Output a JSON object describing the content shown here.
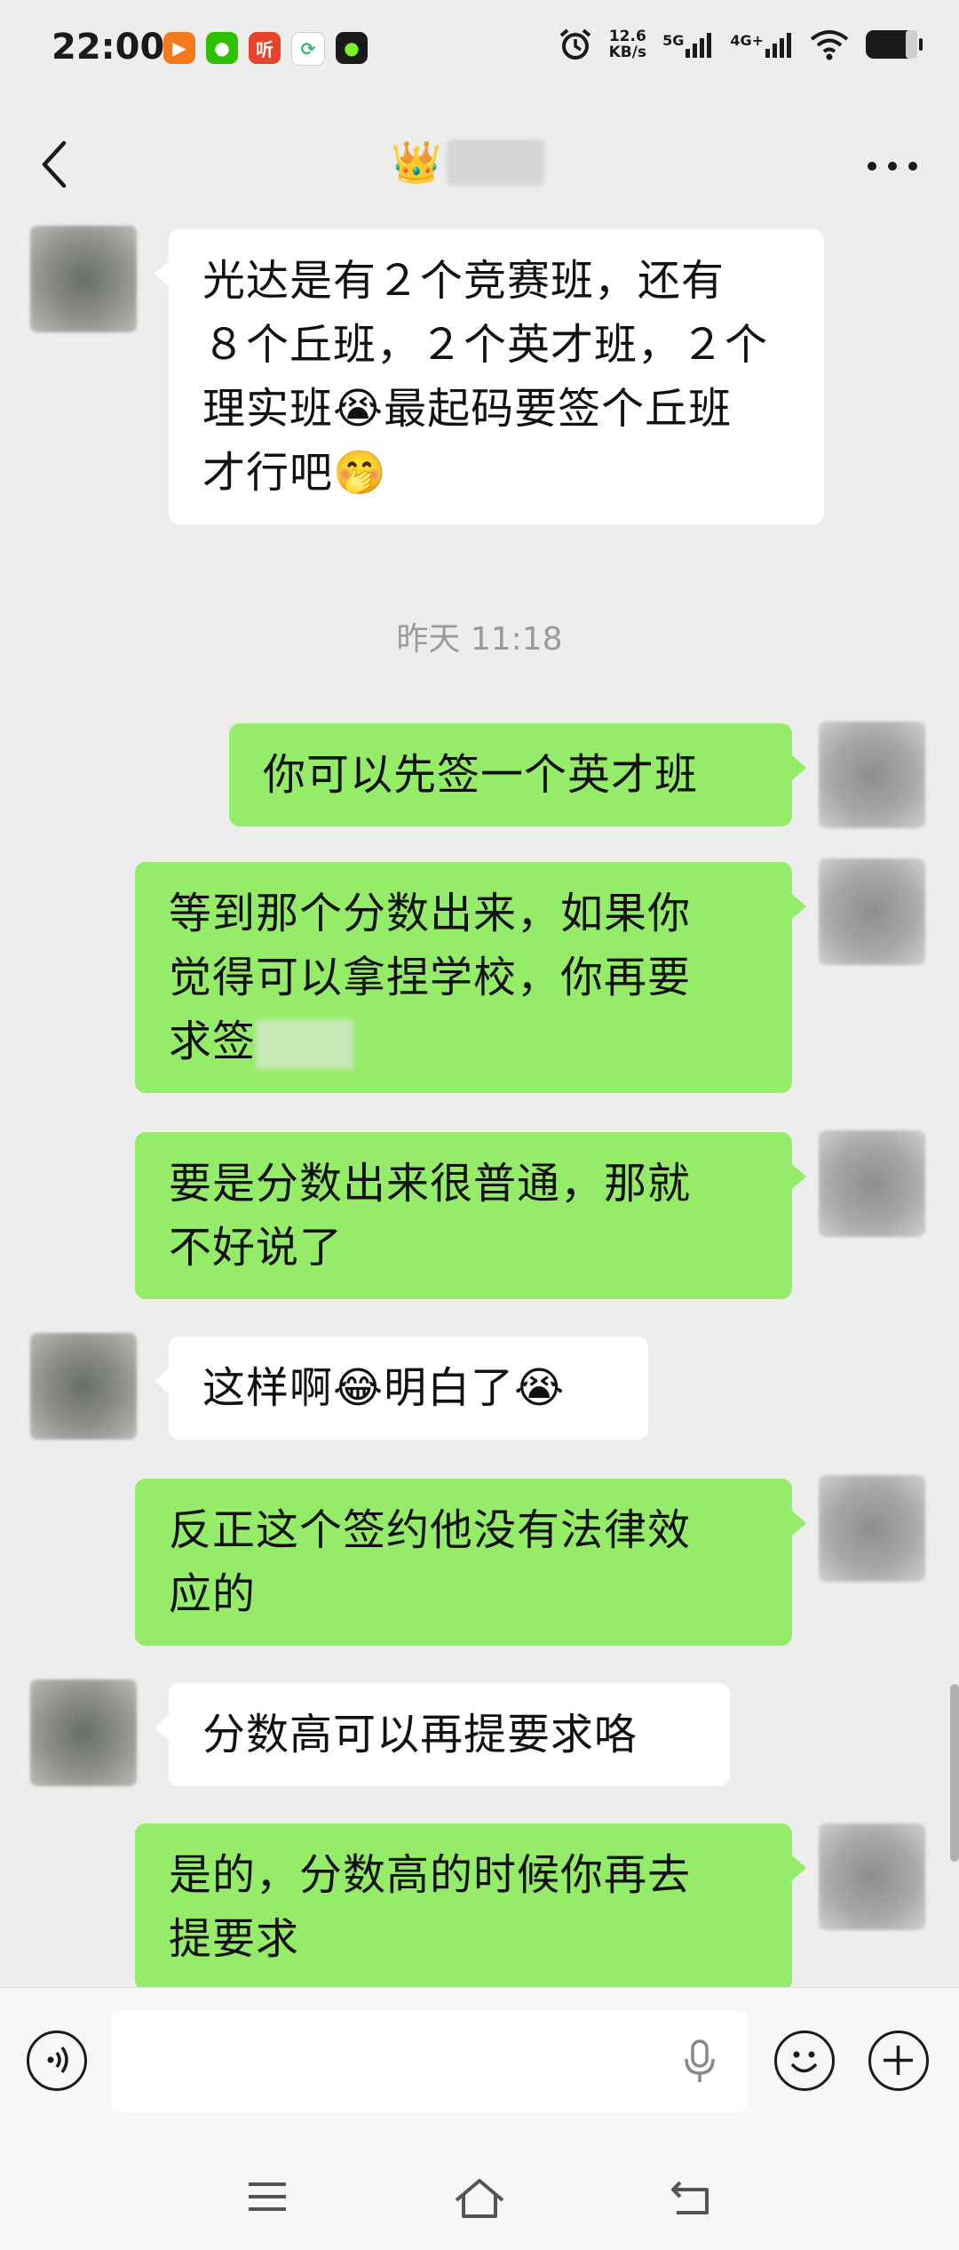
{
  "status_bar": {
    "time": "22:00",
    "app_icons": [
      {
        "name": "video-app-icon",
        "label": "",
        "color": "#f37b1d"
      },
      {
        "name": "wechat-icon",
        "label": "",
        "color": "#2dc100"
      },
      {
        "name": "listen-app-icon",
        "label": "听",
        "color": "#e8412c"
      },
      {
        "name": "sync-app-icon",
        "label": "",
        "color": "#ffffff"
      },
      {
        "name": "green-dot-app-icon",
        "label": "",
        "color": "#1a1a1a"
      }
    ],
    "net_speed_value": "12.6",
    "net_speed_unit": "KB/s",
    "sig1_tag": "5G",
    "sig2_tag": "4G+"
  },
  "nav": {
    "title_emoji": "👑"
  },
  "colors": {
    "background": "#ededed",
    "incoming_bubble": "#ffffff",
    "outgoing_bubble": "#95ec69",
    "timestamp_text": "#9a9a9a"
  },
  "messages": [
    {
      "side": "left",
      "text": "光达是有２个竞赛班，还有\n８个丘班，２个英才班，２个\n理实班😭最起码要签个丘班\n才行吧🤭"
    },
    {
      "timestamp": "昨天 11:18"
    },
    {
      "side": "right",
      "text": "你可以先签一个英才班"
    },
    {
      "side": "right",
      "text_before_blur": "等到那个分数出来，如果你\n觉得可以拿捏学校，你再要\n求签"
    },
    {
      "side": "right",
      "text": "要是分数出来很普通，那就\n不好说了"
    },
    {
      "side": "left",
      "text": "这样啊😂明白了😭"
    },
    {
      "side": "right",
      "text": "反正这个签约他没有法律效\n应的"
    },
    {
      "side": "left",
      "text": "分数高可以再提要求咯"
    },
    {
      "side": "right",
      "text": "是的，分数高的时候你再去\n提要求"
    }
  ]
}
